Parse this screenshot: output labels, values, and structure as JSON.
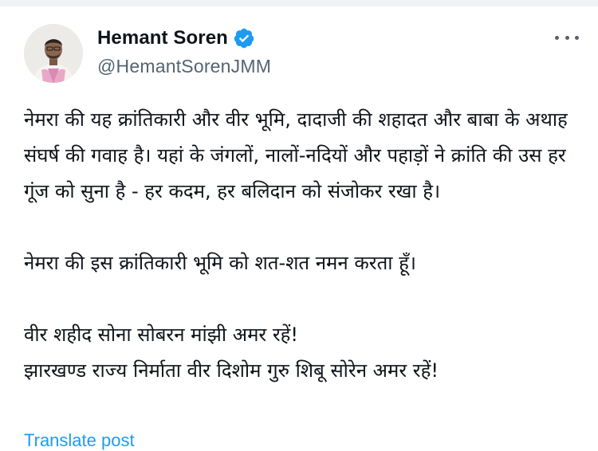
{
  "author": {
    "display_name": "Hemant Soren",
    "handle": "@HemantSorenJMM",
    "verified": true,
    "avatar_icon": "user-avatar-photo"
  },
  "menu": {
    "icon": "more-options-icon"
  },
  "tweet": {
    "paragraph_1": "नेमरा की यह क्रांतिकारी और वीर भूमि, दादाजी की शहादत और बाबा के अथाह संघर्ष की गवाह है। यहां के जंगलों, नालों-नदियों और पहाड़ों ने क्रांति की उस हर गूंज को सुना है - हर कदम, हर बलिदान को संजोकर रखा है।",
    "paragraph_2": "नेमरा की इस क्रांतिकारी भूमि को शत-शत नमन करता हूँ।",
    "paragraph_3_line_1": "वीर शहीद सोना सोबरन मांझी अमर रहें!",
    "paragraph_3_line_2": "झारखण्ड राज्य निर्माता वीर दिशोम गुरु शिबू सोरेन अमर रहें!"
  },
  "translate_link": "Translate post",
  "colors": {
    "verified_badge": "#1d9bf0",
    "link": "#1d9bf0",
    "secondary_text": "#536471",
    "primary_text": "#0f1419"
  }
}
